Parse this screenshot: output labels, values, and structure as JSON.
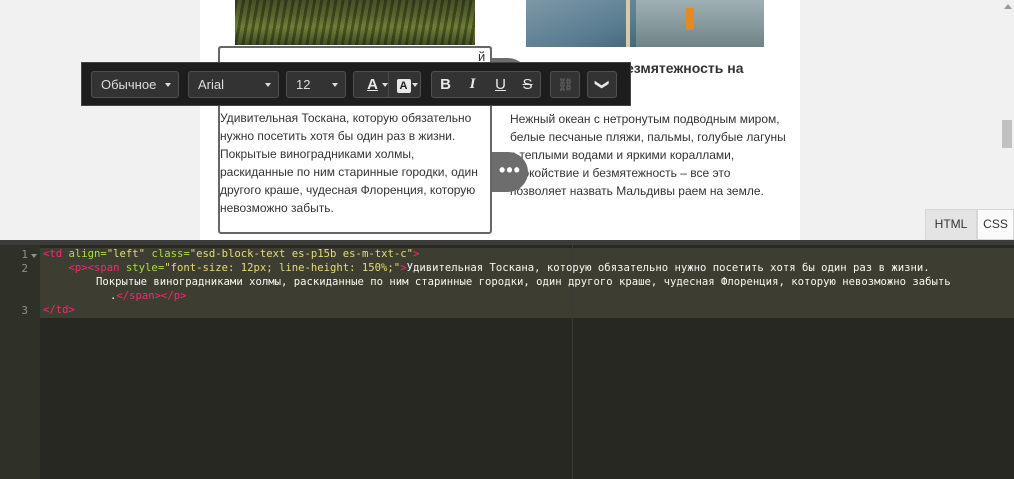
{
  "preview": {
    "left_heading_fragment": "й",
    "left_text": "Удивительная Тоскана, которую обязательно нужно посетить хотя бы один раз в жизни. Покрытые виноградниками холмы, раскиданные по ним старинные городки, один другого краше, чудесная Флоренция, которую невозможно забыть.",
    "right_heading": "езмятежность на",
    "right_text": "Нежный океан с нетронутым подводным миром, белые песчаные пляжи, пальмы, голубые лагуны с теплыми водами и яркими кораллами, спокойствие и безмятежность – все это позволяет назвать Мальдивы раем на земле.",
    "dots": "•••"
  },
  "toolbar": {
    "style": "Обычное",
    "font": "Arial",
    "size": "12",
    "text_color_glyph": "A",
    "bg_color_glyph": "A",
    "bold": "B",
    "italic": "I",
    "underline": "U",
    "strike": "S",
    "link_glyph": "⛓",
    "more_glyph": "❯"
  },
  "tabs": {
    "html": "HTML",
    "css": "CSS"
  },
  "editor": {
    "line_numbers": [
      "1",
      "2",
      "3"
    ],
    "line1": {
      "tag_open": "<td",
      "attr1": " align=",
      "val1": "\"left\"",
      "attr2": " class=",
      "val2": "\"esd-block-text es-p15b es-m-txt-c\"",
      "tag_close": ">"
    },
    "line2": {
      "indent": "    ",
      "p_open": "<p>",
      "span_open": "<span",
      "attr": " style=",
      "val": "\"font-size: 12px; line-height: 150%;\"",
      "gt": ">",
      "text_a": "Удивительная Тоскана, которую обязательно нужно посетить хотя бы один раз в жизни.",
      "text_b": "Покрытые виноградниками холмы, раскиданные по ним старинные городки, один другого краше, чудесная Флоренция, которую невозможно забыть",
      "text_c": ".",
      "close_tags": "</span></p>"
    },
    "line3": {
      "tag": "</td>"
    }
  },
  "colors": {
    "editor_bg": "#272822",
    "toolbar_bg": "#1d1d1d",
    "tag": "#f92672",
    "attr": "#a6e22e",
    "string": "#e6db74"
  }
}
